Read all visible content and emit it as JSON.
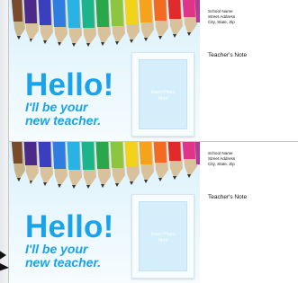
{
  "cards": [
    {
      "greeting": "Hello!",
      "message_line1": "I'll be your",
      "message_line2": "new teacher.",
      "photo_placeholder_line1": "Insert Photo",
      "photo_placeholder_line2": "Here",
      "address": [
        "School Name",
        "Street Address",
        "City, State, Zip"
      ],
      "note_label": "Teacher's Note"
    },
    {
      "greeting": "Hello!",
      "message_line1": "I'll be your",
      "message_line2": "new teacher.",
      "photo_placeholder_line1": "Insert Photo",
      "photo_placeholder_line2": "Here",
      "address": [
        "School Name",
        "Street Address",
        "City, State, Zip"
      ],
      "note_label": "Teacher's Note"
    }
  ],
  "colors": {
    "accent_blue": "#1aa3e8",
    "photo_bg": "#d5eefb",
    "background_gradient_top": "#d9f0fb"
  }
}
